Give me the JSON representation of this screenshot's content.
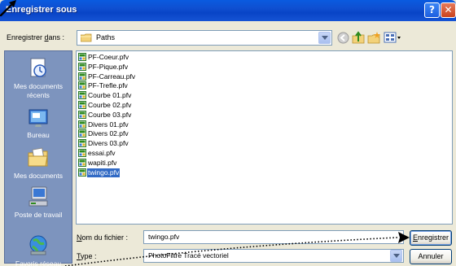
{
  "window": {
    "title": "Enregistrer sous",
    "help_glyph": "?",
    "close_glyph": "✕"
  },
  "lookin": {
    "label_pre": "Enregistrer ",
    "label_access": "d",
    "label_post": "ans :",
    "value": "Paths"
  },
  "toolbar": {
    "icons": [
      "back-icon",
      "up-folder-icon",
      "new-folder-icon",
      "view-menu-icon"
    ]
  },
  "places": [
    {
      "label": "Mes documents récents",
      "icon": "recent-documents-icon"
    },
    {
      "label": "Bureau",
      "icon": "desktop-icon"
    },
    {
      "label": "Mes documents",
      "icon": "my-documents-icon"
    },
    {
      "label": "Poste de travail",
      "icon": "my-computer-icon"
    },
    {
      "label": "Favoris réseau",
      "icon": "network-places-icon"
    }
  ],
  "files": [
    {
      "name": "PF-Coeur.pfv",
      "selected": false
    },
    {
      "name": "PF-Pique.pfv",
      "selected": false
    },
    {
      "name": "PF-Carreau.pfv",
      "selected": false
    },
    {
      "name": "PF-Trefle.pfv",
      "selected": false
    },
    {
      "name": "Courbe 01.pfv",
      "selected": false
    },
    {
      "name": "Courbe 02.pfv",
      "selected": false
    },
    {
      "name": "Courbe 03.pfv",
      "selected": false
    },
    {
      "name": "Divers 01.pfv",
      "selected": false
    },
    {
      "name": "Divers 02.pfv",
      "selected": false
    },
    {
      "name": "Divers 03.pfv",
      "selected": false
    },
    {
      "name": "essai.pfv",
      "selected": false
    },
    {
      "name": "wapiti.pfv",
      "selected": false
    },
    {
      "name": "twingo.pfv",
      "selected": true
    }
  ],
  "filename": {
    "label_access": "N",
    "label_post": "om du fichier :",
    "value": "twingo.pfv"
  },
  "filetype": {
    "label_access": "T",
    "label_post": "ype :",
    "value": "PhotoFiltre Tracé vectoriel"
  },
  "buttons": {
    "save_access": "E",
    "save_post": "nregistrer",
    "cancel": "Annuler"
  },
  "colors": {
    "titlebar": "#0a5be0",
    "dialog_bg": "#ece9d8",
    "places_bar": "#7d94be",
    "selection": "#316ac5"
  }
}
